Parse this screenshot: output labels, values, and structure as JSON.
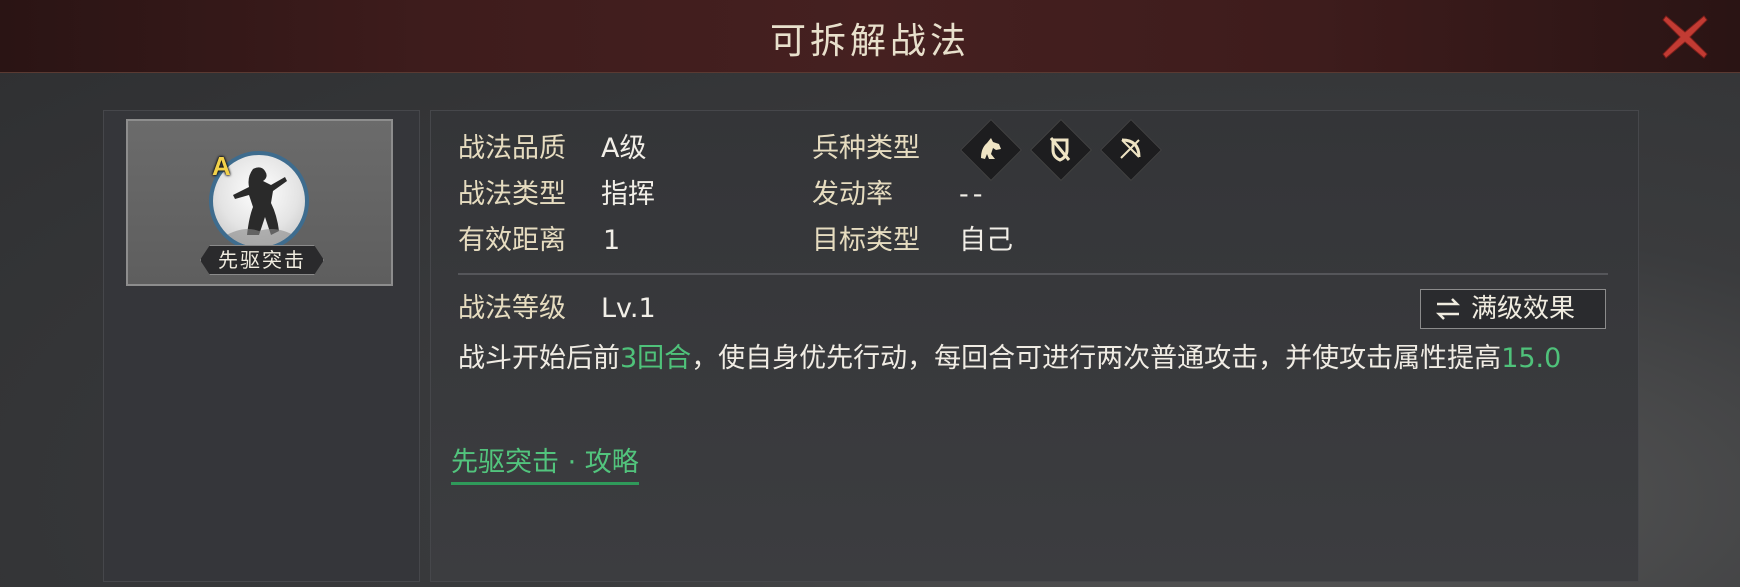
{
  "dialog": {
    "title": "可拆解战法",
    "close_icon": "close-x-icon",
    "accent_color": "#c23b33"
  },
  "skill_card": {
    "grade": "A",
    "name": "先驱突击",
    "portrait_icon": "warrior-portrait-icon"
  },
  "details": {
    "quality_label": "战法品质",
    "quality_value": "A级",
    "type_label": "战法类型",
    "type_value": "指挥",
    "range_label": "有效距离",
    "range_value": "1",
    "unit_label": "兵种类型",
    "unit_icons": [
      "cavalry-icon",
      "shield-icon",
      "bow-icon"
    ],
    "rate_label": "发动率",
    "rate_value": "--",
    "target_label": "目标类型",
    "target_value": "自己"
  },
  "level": {
    "label": "战法等级",
    "value": "Lv.1",
    "max_button": "满级效果",
    "max_button_icon": "swap-arrows-icon"
  },
  "description": {
    "p1": "战斗开始后前",
    "h1": "3回合",
    "p2": "，使自身优先行动，每回合可进行两次普通攻击，并使攻击属性提高",
    "h2": "15.0",
    "highlight_color": "#4fc27a"
  },
  "guide_link": "先驱突击 · 攻略"
}
